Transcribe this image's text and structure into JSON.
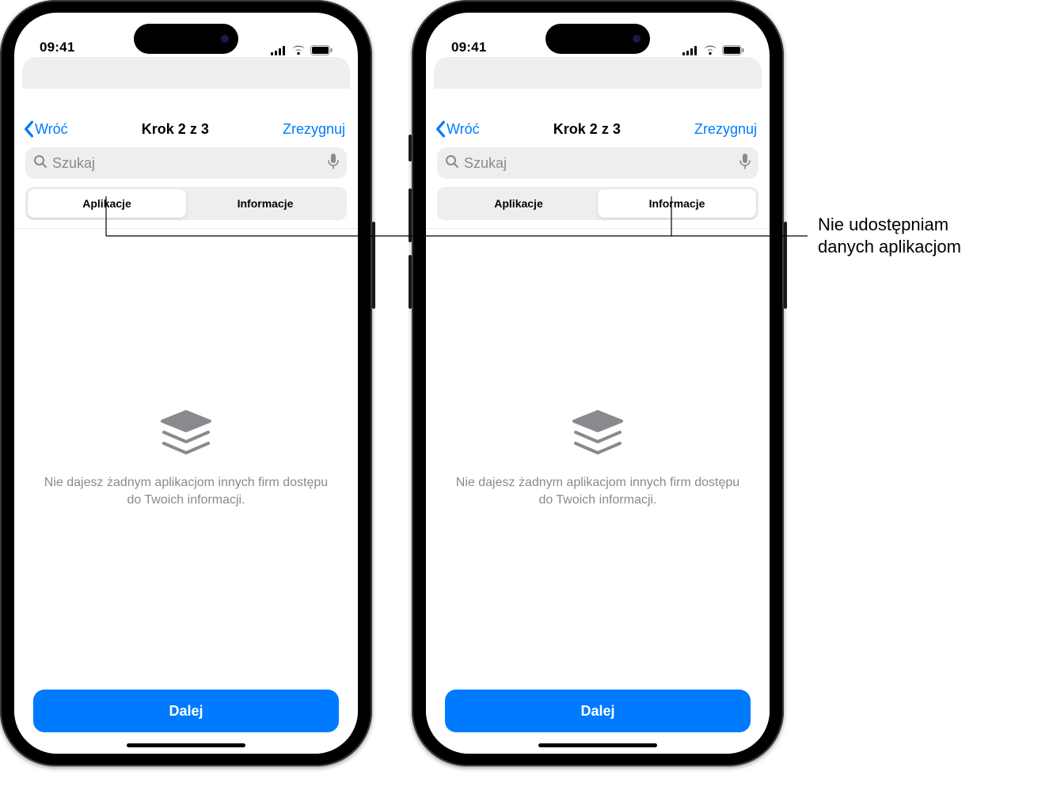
{
  "status": {
    "time": "09:41"
  },
  "nav": {
    "back_label": "Wróć",
    "title": "Krok 2 z 3",
    "cancel_label": "Zrezygnuj"
  },
  "search": {
    "placeholder": "Szukaj"
  },
  "segments": {
    "apps": "Aplikacje",
    "info": "Informacje"
  },
  "empty_state": {
    "message": "Nie dajesz żadnym aplikacjom innych firm dostępu do Twoich informacji."
  },
  "primary_action": {
    "label": "Dalej"
  },
  "callout": {
    "line1": "Nie udostępniam",
    "line2": "danych aplikacjom"
  }
}
